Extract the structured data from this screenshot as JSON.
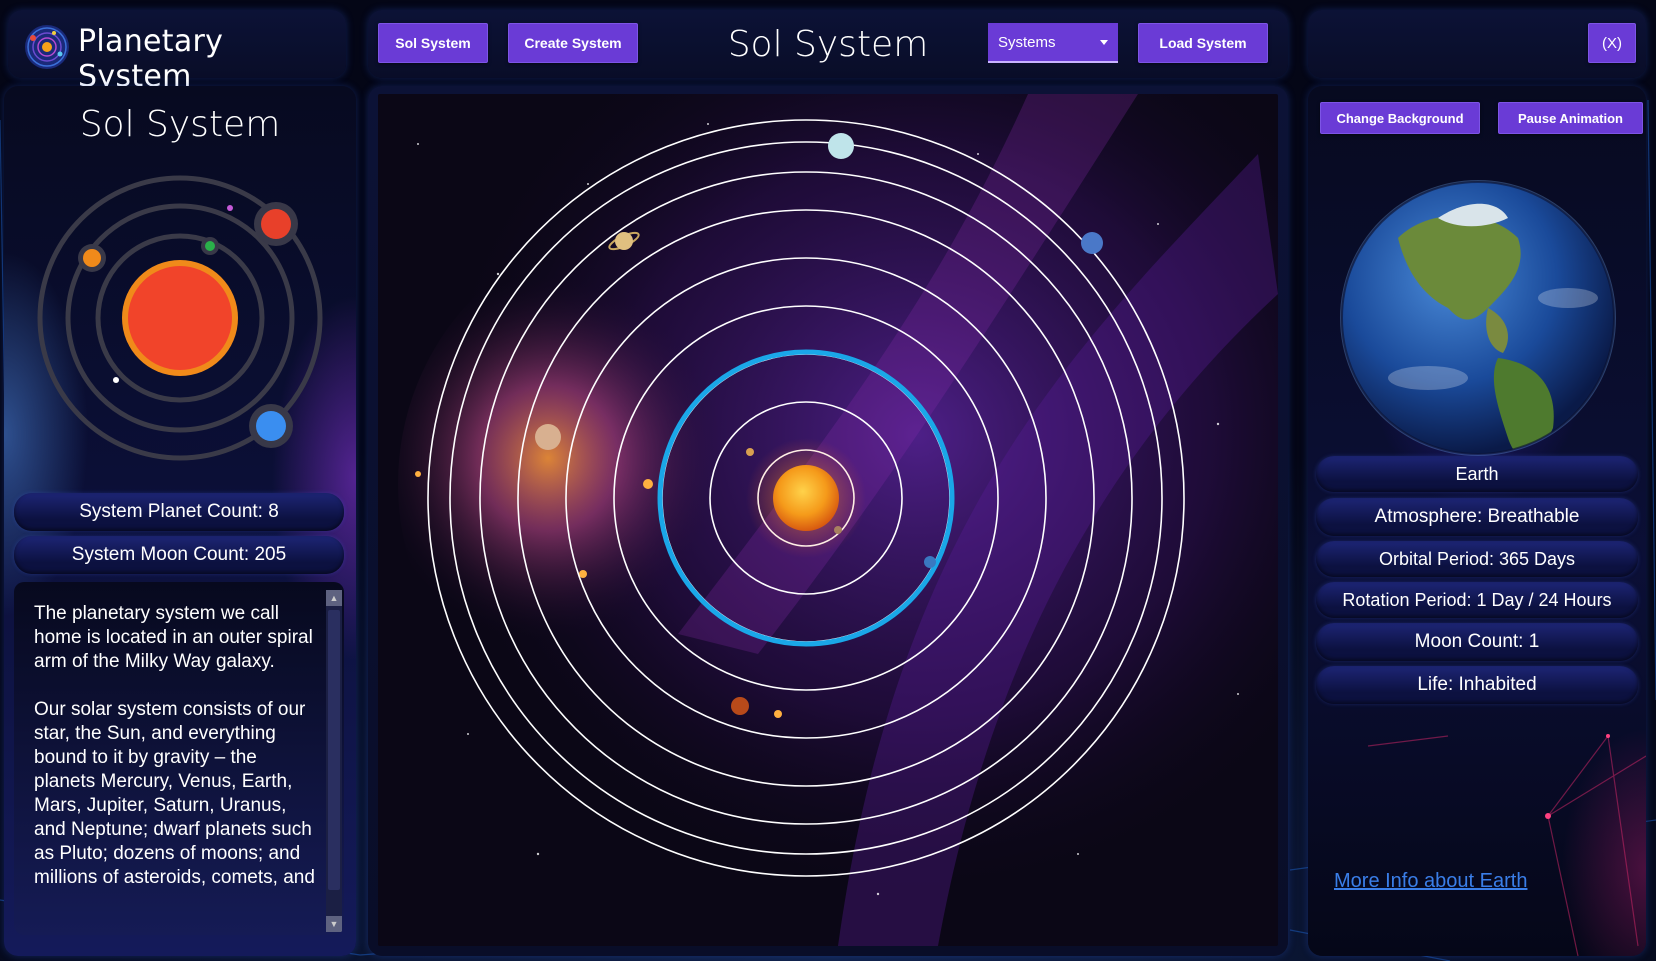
{
  "app": {
    "title": "Planetary System"
  },
  "header": {
    "title": "Sol System",
    "sol_button": "Sol System",
    "create_button": "Create System",
    "systems_select": "Systems",
    "load_button": "Load System",
    "close_button": "(X)"
  },
  "left": {
    "system_title": "Sol System",
    "planet_count": "System Planet Count: 8",
    "moon_count": "System Moon Count: 205",
    "description_p1": "The planetary system we call home is located in an outer spiral arm of the Milky Way galaxy.",
    "description_p2": "Our solar system consists of our star, the Sun, and everything bound to it by gravity – the planets Mercury, Venus, Earth, Mars, Jupiter, Saturn, Uranus, and Neptune; dwarf planets such as Pluto; dozens of moons; and millions of asteroids, comets, and"
  },
  "right": {
    "change_bg_button": "Change Background",
    "pause_button": "Pause Animation",
    "planet_name": "Earth",
    "atmosphere": "Atmosphere: Breathable",
    "orbital_period": "Orbital Period: 365 Days",
    "rotation_period": "Rotation Period: 1 Day / 24 Hours",
    "moon_count": "Moon Count: 1",
    "life": "Life: Inhabited",
    "more_info_link": "More Info about Earth"
  },
  "colors": {
    "button": "#6a3bd6",
    "highlight_orbit": "#1aa7e8",
    "link": "#3a7ee8"
  },
  "icons": {
    "logo": "solar-system-logo-icon",
    "select_caret": "caret-down-icon"
  }
}
